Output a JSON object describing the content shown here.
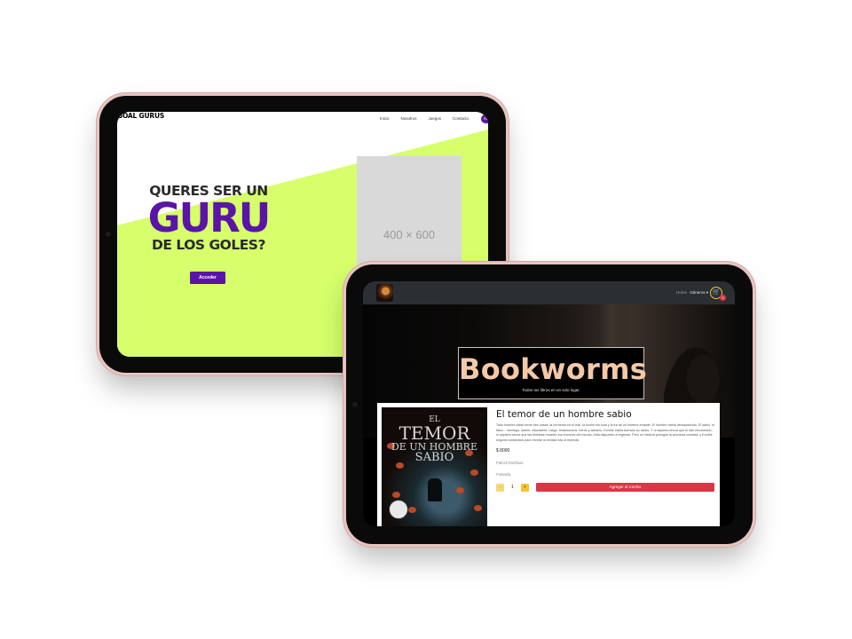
{
  "colors": {
    "goal_gurus_accent": "#5b14a8",
    "goal_gurus_lime": "#d6ff6b",
    "bookworms_title": "#f3c9a8",
    "bookworms_cart": "#f4c430",
    "bookworms_button": "#dc3545"
  },
  "goal_gurus": {
    "logo": "GOAL GURUS",
    "nav_links": [
      "Inicio",
      "Nosotros",
      "Juegos",
      "Contacto"
    ],
    "nav_pill": "Re",
    "headline_top": "QUERES SER UN",
    "headline_main": "GURU",
    "headline_bottom": "DE LOS GOLES?",
    "cta_button": "Acceder",
    "image_placeholder": "400 × 600"
  },
  "bookworms": {
    "nav": {
      "logo_icon": "book-logo-icon",
      "home": "Home",
      "genres": "Géneros ▾",
      "cart_icon": "cart-icon",
      "cart_count": "0"
    },
    "hero": {
      "title": "Bookworms",
      "tagline": "Todos tus libros en un solo lugar."
    },
    "book": {
      "cover_small": "EL",
      "cover_title_1": "TEMOR",
      "cover_title_2": "DE UN HOMBRE",
      "cover_title_3": "SABIO",
      "title": "El temor de un hombre sabio",
      "description": "Todo hombre sabio teme tres cosas: la tormenta en el mar, la noche sin luna y la ira de un hombre amable. El hombre había desaparecido. El sabio, el falso... mendigo, ladrón, estudiante, mago, trotamundos, héroe y asesino. Kvothe había borrado su rastro. Y ni siquiera ahora que le han encontrado, ni siquiera ahora que las tinieblas invaden los rincones del mundo, está dispuesto a regresar. Pero su historia persigue la aventura contada, y Kvothe seguirá contándola para revelar la verdad tras la leyenda.",
      "price": "$ 8000",
      "author": "Patrick Rothfuss",
      "genre": "Fantasía",
      "quantity": "1",
      "minus": "-",
      "plus": "+",
      "add_to_cart": "Agregar al Carrito"
    }
  }
}
